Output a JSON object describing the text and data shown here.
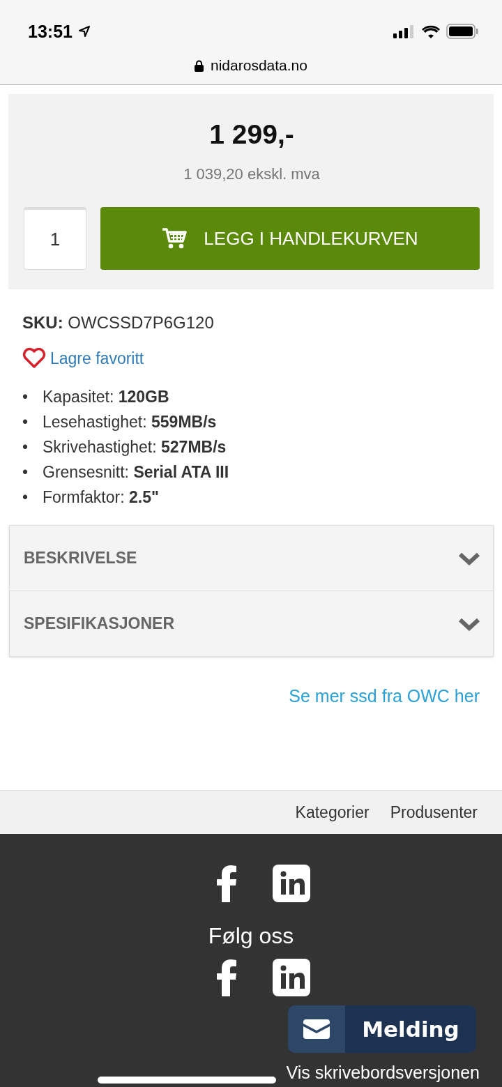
{
  "status_bar": {
    "time": "13:51"
  },
  "address_bar": {
    "url": "nidarosdata.no"
  },
  "price_panel": {
    "price": "1 299,-",
    "price_ex_vat": "1 039,20 ekskl. mva",
    "quantity": "1",
    "add_to_cart": "LEGG I HANDLEKURVEN"
  },
  "sku": {
    "label": "SKU:",
    "value": "OWCSSD7P6G120"
  },
  "favorite": {
    "label": "Lagre favoritt"
  },
  "specs": [
    {
      "marker": "•",
      "label": "Kapasitet:",
      "value": "120GB"
    },
    {
      "marker": "•",
      "label": "Lesehastighet:",
      "value": "559MB/s"
    },
    {
      "marker": "•",
      "label": "Skrivehastighet:",
      "value": "527MB/s"
    },
    {
      "marker": "•",
      "label": "Grensesnitt:",
      "value": "Serial ATA III"
    },
    {
      "marker": "•",
      "label": "Formfaktor:",
      "value": "2.5\""
    }
  ],
  "accordion": [
    {
      "title": "BESKRIVELSE",
      "expanded": false
    },
    {
      "title": "SPESIFIKASJONER",
      "expanded": false
    }
  ],
  "more_link": "Se mer ssd fra OWC her",
  "footer_nav": [
    "Kategorier",
    "Produsenter"
  ],
  "footer": {
    "follow": "Følg oss",
    "desktop_link": "Vis skrivebordsversjonen"
  },
  "chat_button": {
    "label": "Melding"
  }
}
